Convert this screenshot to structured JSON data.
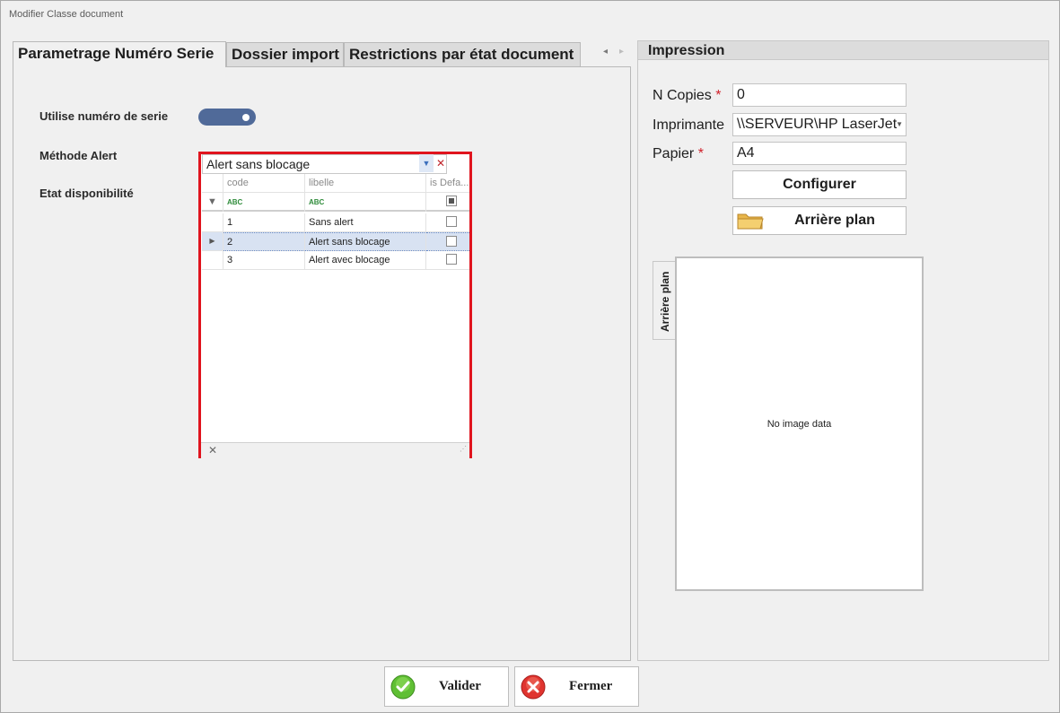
{
  "window": {
    "title": "Modifier Classe document"
  },
  "tabs": [
    {
      "label": "Parametrage Numéro Serie",
      "active": true
    },
    {
      "label": "Dossier import",
      "active": false
    },
    {
      "label": "Restrictions par état document",
      "active": false
    }
  ],
  "tab_nav": {
    "prev": "◂",
    "next": "▸"
  },
  "form": {
    "utilise_label": "Utilise numéro de serie",
    "utilise_value": true,
    "methode_label": "Méthode Alert",
    "etat_label": "Etat disponibilité"
  },
  "lookup": {
    "value": "Alert sans blocage",
    "columns": [
      "code",
      "libelle",
      "is Defa..."
    ],
    "filter_glyph": "ABC",
    "rows": [
      {
        "code": "1",
        "libelle": "Sans alert",
        "is_default": false,
        "selected": false
      },
      {
        "code": "2",
        "libelle": "Alert sans blocage",
        "is_default": false,
        "selected": true
      },
      {
        "code": "3",
        "libelle": "Alert avec blocage",
        "is_default": false,
        "selected": false
      }
    ],
    "close_glyph": "✕"
  },
  "impression": {
    "header": "Impression",
    "copies_label": "N Copies",
    "copies_value": "0",
    "imprimante_label": "Imprimante",
    "imprimante_value": "\\\\SERVEUR\\HP LaserJet",
    "papier_label": "Papier",
    "papier_value": "A4",
    "required_mark": "*",
    "configurer_button": "Configurer",
    "arriere_button": "Arrière plan",
    "image_tab_label": "Arrière plan",
    "no_image_text": "No image data"
  },
  "footer": {
    "valider_label": "Valider",
    "fermer_label": "Fermer"
  },
  "colors": {
    "toggle_on": "#506a99",
    "highlight_border": "#e0141e",
    "selected_row": "#d8e2f2",
    "ok_green": "#4caf2a",
    "close_red": "#d9262a"
  }
}
